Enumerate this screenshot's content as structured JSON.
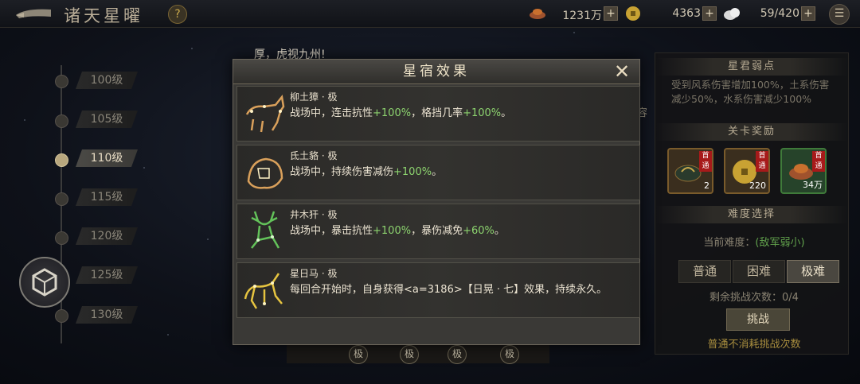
{
  "header": {
    "title": "诸天星曜",
    "help_label": "?",
    "menu_label": "☰",
    "resources": [
      {
        "icon": "ingot-icon",
        "value": "1231万",
        "plus": "+"
      },
      {
        "icon": "coin-icon",
        "value": "4363",
        "plus": "+"
      },
      {
        "icon": "stamina-icon",
        "value": "59/420",
        "plus": "+"
      }
    ]
  },
  "levels": [
    "100级",
    "105级",
    "110级",
    "115级",
    "120级",
    "125级",
    "130级"
  ],
  "active_level": "110级",
  "background": {
    "quote": "厚，虎视九州!",
    "cut_text": "容",
    "bottom_chip": "极"
  },
  "modal": {
    "title": "星宿效果",
    "close_label": "✕",
    "items": [
      {
        "name": "柳土獐 · 极",
        "desc_parts": [
          "战场中，连击抗性",
          "+100%",
          "，格挡几率",
          "+100%",
          "。"
        ],
        "icon": "deer-constellation-icon"
      },
      {
        "name": "氐土貉 · 极",
        "desc_parts": [
          "战场中，持续伤害减伤",
          "+100%",
          "。"
        ],
        "icon": "badger-constellation-icon"
      },
      {
        "name": "井木犴 · 极",
        "desc_parts": [
          "战场中，暴击抗性",
          "+100%",
          "，暴伤减免",
          "+60%",
          "。"
        ],
        "icon": "stag-constellation-icon"
      },
      {
        "name": "星日马 · 极",
        "desc_parts": [
          "每回合开始时，自身获得<a=3186>【日晃 · 七】效果，持续永久。"
        ],
        "icon": "horse-constellation-icon"
      }
    ]
  },
  "right_panel": {
    "weak_header": "星君弱点",
    "weak_text": "受到风系伤害增加100%，土系伤害减少50%，水系伤害减少100%",
    "reward_header": "关卡奖励",
    "rewards": [
      {
        "tag": "首通",
        "count": "2"
      },
      {
        "tag": "首通",
        "count": "220"
      },
      {
        "tag": "首通",
        "count": "34万"
      }
    ],
    "difficulty_header": "难度选择",
    "current_label": "当前难度：",
    "current_value": "(敌军弱小)",
    "difficulties": [
      "普通",
      "困难",
      "极难"
    ],
    "selected_difficulty": "极难",
    "remaining": "剩余挑战次数：0/4",
    "challenge": "挑战",
    "note": "普通不消耗挑战次数"
  },
  "colors": {
    "green_value": "#8dd46f",
    "gold_note": "#a88d3e",
    "first_clear_tag": "#a71a1a"
  }
}
